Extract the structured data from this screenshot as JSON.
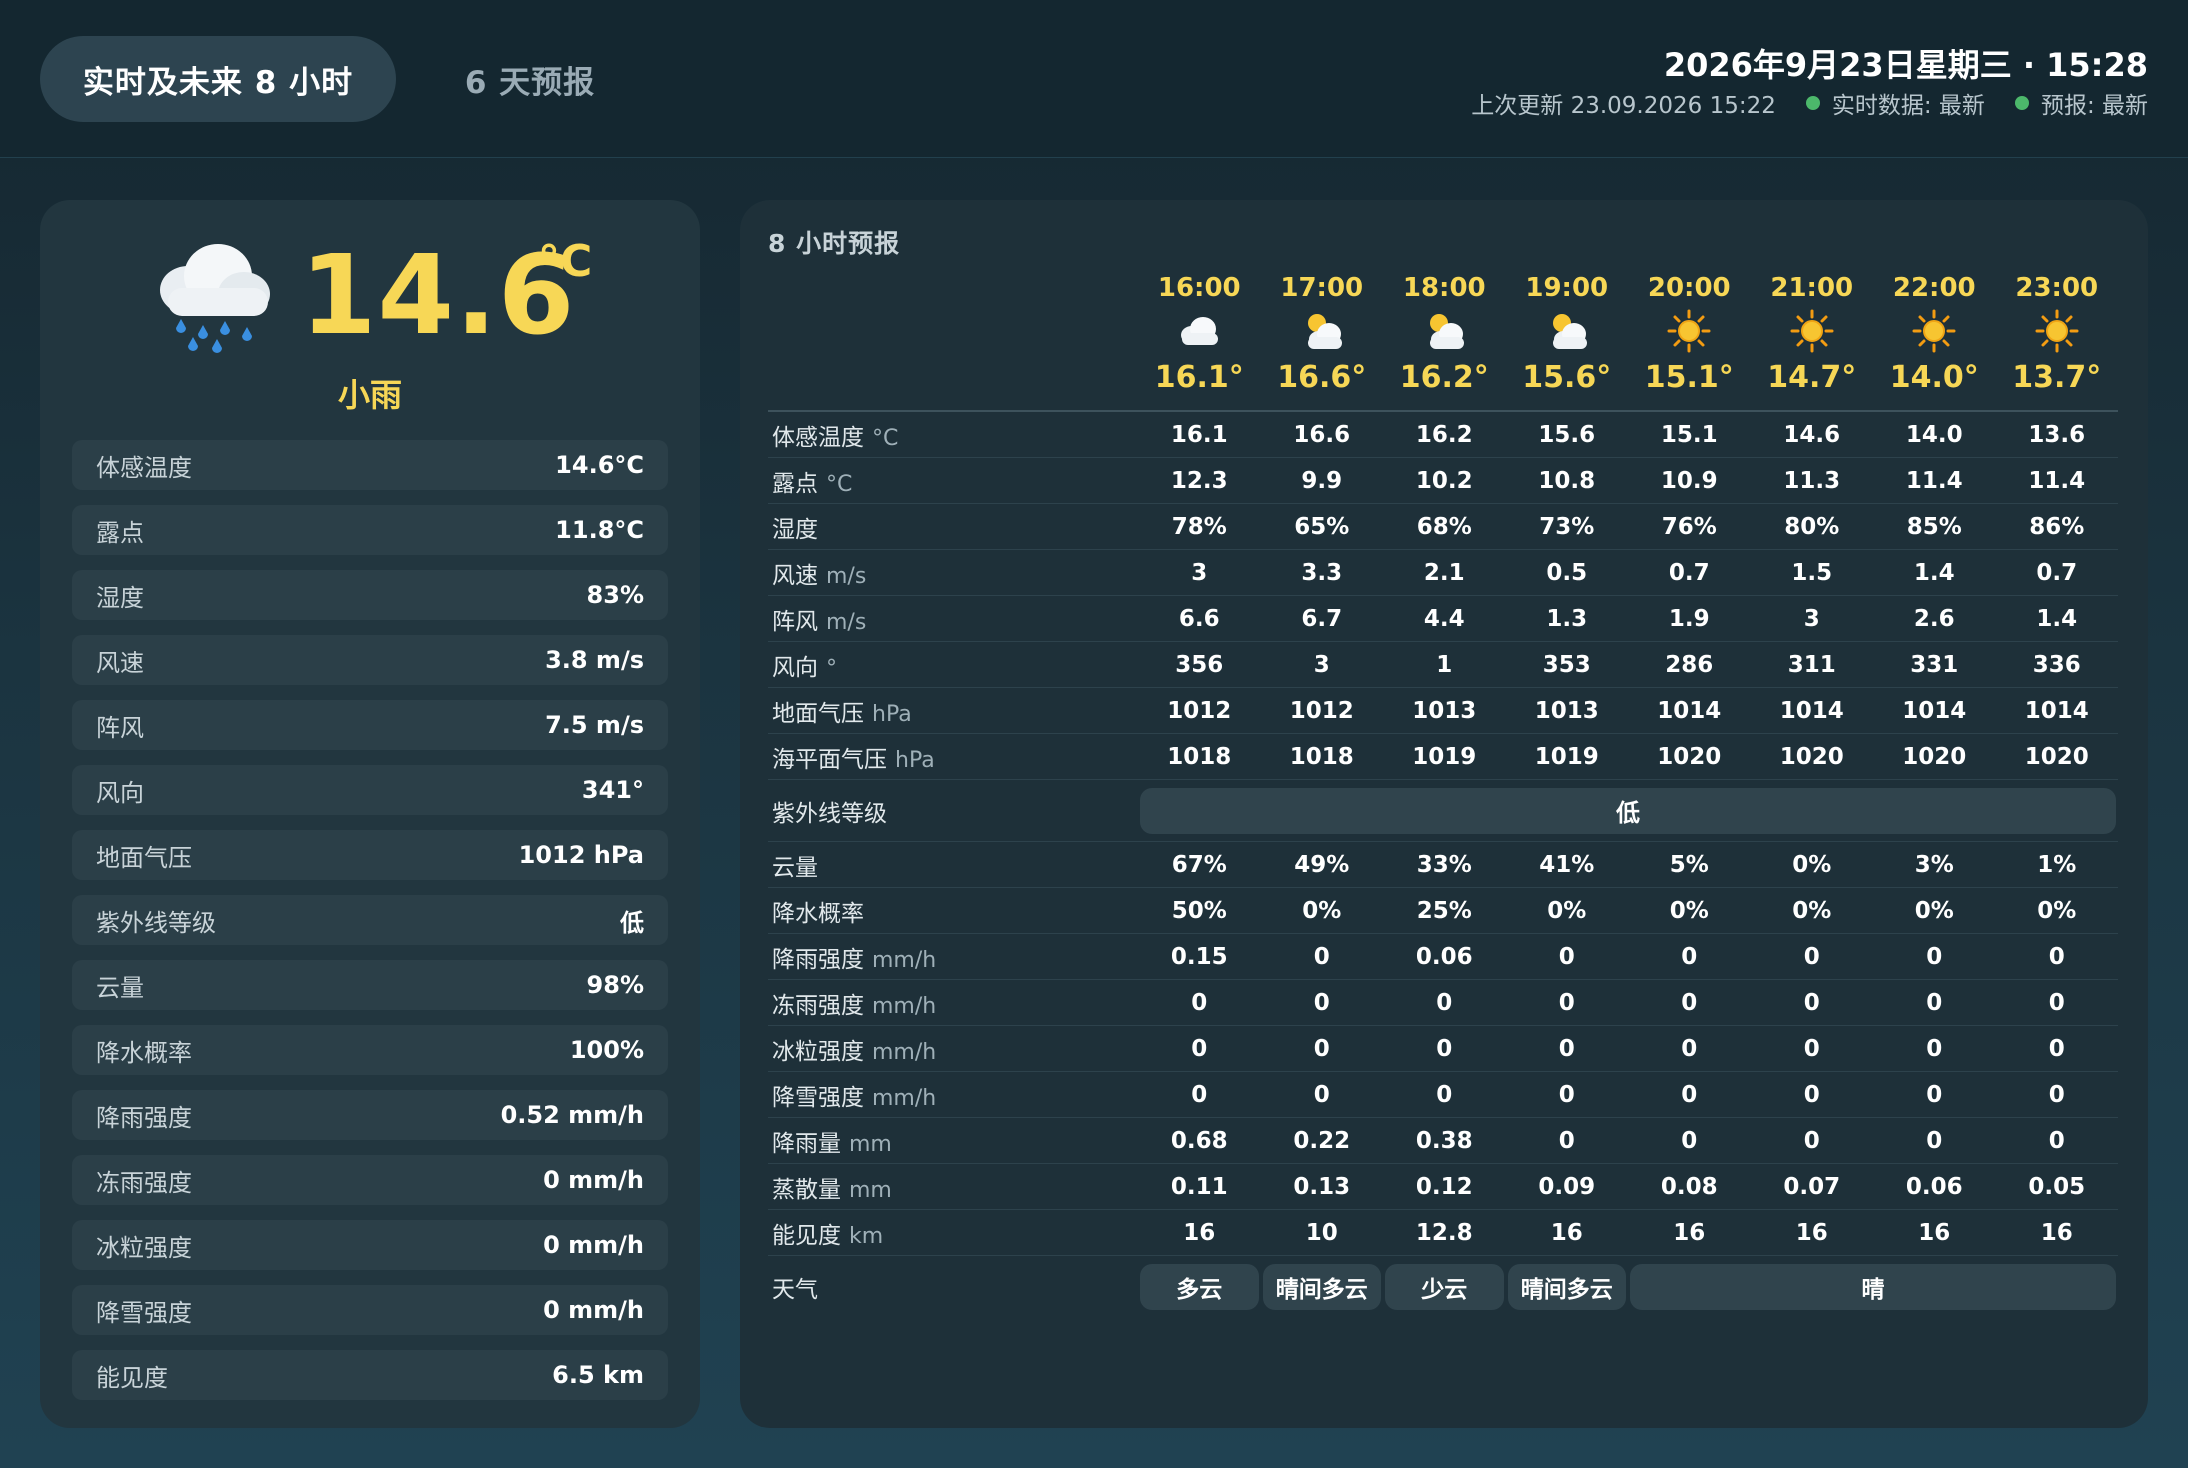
{
  "header": {
    "tab_active": "实时及未来 8 小时",
    "tab_inactive": "6 天预报",
    "datetime": "2026年9月23日星期三 · 15:28",
    "last_update": "上次更新 23.09.2026 15:22",
    "realtime_status": "实时数据:  最新",
    "forecast_status": "预报:  最新",
    "status_color": "#4cb86b"
  },
  "current": {
    "icon": "rain-cloud-icon",
    "temperature": "14.6",
    "unit": "°C",
    "condition": "小雨",
    "rows": [
      {
        "label": "体感温度",
        "value": "14.6°C"
      },
      {
        "label": "露点",
        "value": "11.8°C"
      },
      {
        "label": "湿度",
        "value": "83%"
      },
      {
        "label": "风速",
        "value": "3.8 m/s"
      },
      {
        "label": "阵风",
        "value": "7.5 m/s"
      },
      {
        "label": "风向",
        "value": "341°"
      },
      {
        "label": "地面气压",
        "value": "1012 hPa"
      },
      {
        "label": "紫外线等级",
        "value": "低"
      },
      {
        "label": "云量",
        "value": "98%"
      },
      {
        "label": "降水概率",
        "value": "100%"
      },
      {
        "label": "降雨强度",
        "value": "0.52 mm/h"
      },
      {
        "label": "冻雨强度",
        "value": "0 mm/h"
      },
      {
        "label": "冰粒强度",
        "value": "0 mm/h"
      },
      {
        "label": "降雪强度",
        "value": "0 mm/h"
      },
      {
        "label": "能见度",
        "value": "6.5 km"
      }
    ]
  },
  "forecast": {
    "title": "8 小时预报",
    "hours": [
      {
        "time": "16:00",
        "icon": "cloud-icon",
        "temp": "16.1°"
      },
      {
        "time": "17:00",
        "icon": "partly-sunny-icon",
        "temp": "16.6°"
      },
      {
        "time": "18:00",
        "icon": "partly-sunny-icon",
        "temp": "16.2°"
      },
      {
        "time": "19:00",
        "icon": "partly-sunny-icon",
        "temp": "15.6°"
      },
      {
        "time": "20:00",
        "icon": "sun-icon",
        "temp": "15.1°"
      },
      {
        "time": "21:00",
        "icon": "sun-icon",
        "temp": "14.7°"
      },
      {
        "time": "22:00",
        "icon": "sun-icon",
        "temp": "14.0°"
      },
      {
        "time": "23:00",
        "icon": "sun-icon",
        "temp": "13.7°"
      }
    ],
    "rows_top": [
      {
        "label": "体感温度",
        "unit": "°C",
        "values": [
          "16.1",
          "16.6",
          "16.2",
          "15.6",
          "15.1",
          "14.6",
          "14.0",
          "13.6"
        ]
      },
      {
        "label": "露点",
        "unit": "°C",
        "values": [
          "12.3",
          "9.9",
          "10.2",
          "10.8",
          "10.9",
          "11.3",
          "11.4",
          "11.4"
        ]
      },
      {
        "label": "湿度",
        "unit": "",
        "values": [
          "78%",
          "65%",
          "68%",
          "73%",
          "76%",
          "80%",
          "85%",
          "86%"
        ]
      },
      {
        "label": "风速",
        "unit": "m/s",
        "values": [
          "3",
          "3.3",
          "2.1",
          "0.5",
          "0.7",
          "1.5",
          "1.4",
          "0.7"
        ]
      },
      {
        "label": "阵风",
        "unit": "m/s",
        "values": [
          "6.6",
          "6.7",
          "4.4",
          "1.3",
          "1.9",
          "3",
          "2.6",
          "1.4"
        ]
      },
      {
        "label": "风向",
        "unit": "°",
        "values": [
          "356",
          "3",
          "1",
          "353",
          "286",
          "311",
          "331",
          "336"
        ]
      },
      {
        "label": "地面气压",
        "unit": "hPa",
        "values": [
          "1012",
          "1012",
          "1013",
          "1013",
          "1014",
          "1014",
          "1014",
          "1014"
        ]
      },
      {
        "label": "海平面气压",
        "unit": "hPa",
        "values": [
          "1018",
          "1018",
          "1019",
          "1019",
          "1020",
          "1020",
          "1020",
          "1020"
        ]
      }
    ],
    "uv": {
      "label": "紫外线等级",
      "value": "低"
    },
    "rows_bottom": [
      {
        "label": "云量",
        "unit": "",
        "values": [
          "67%",
          "49%",
          "33%",
          "41%",
          "5%",
          "0%",
          "3%",
          "1%"
        ]
      },
      {
        "label": "降水概率",
        "unit": "",
        "values": [
          "50%",
          "0%",
          "25%",
          "0%",
          "0%",
          "0%",
          "0%",
          "0%"
        ]
      },
      {
        "label": "降雨强度",
        "unit": "mm/h",
        "values": [
          "0.15",
          "0",
          "0.06",
          "0",
          "0",
          "0",
          "0",
          "0"
        ]
      },
      {
        "label": "冻雨强度",
        "unit": "mm/h",
        "values": [
          "0",
          "0",
          "0",
          "0",
          "0",
          "0",
          "0",
          "0"
        ]
      },
      {
        "label": "冰粒强度",
        "unit": "mm/h",
        "values": [
          "0",
          "0",
          "0",
          "0",
          "0",
          "0",
          "0",
          "0"
        ]
      },
      {
        "label": "降雪强度",
        "unit": "mm/h",
        "values": [
          "0",
          "0",
          "0",
          "0",
          "0",
          "0",
          "0",
          "0"
        ]
      },
      {
        "label": "降雨量",
        "unit": "mm",
        "values": [
          "0.68",
          "0.22",
          "0.38",
          "0",
          "0",
          "0",
          "0",
          "0"
        ]
      },
      {
        "label": "蒸散量",
        "unit": "mm",
        "values": [
          "0.11",
          "0.13",
          "0.12",
          "0.09",
          "0.08",
          "0.07",
          "0.06",
          "0.05"
        ]
      },
      {
        "label": "能见度",
        "unit": "km",
        "values": [
          "16",
          "10",
          "12.8",
          "16",
          "16",
          "16",
          "16",
          "16"
        ]
      }
    ],
    "weather": {
      "label": "天气",
      "segments": [
        {
          "text": "多云",
          "span": 1
        },
        {
          "text": "晴间多云",
          "span": 1
        },
        {
          "text": "少云",
          "span": 1
        },
        {
          "text": "晴间多云",
          "span": 1
        },
        {
          "text": "晴",
          "span": 4
        }
      ]
    }
  }
}
